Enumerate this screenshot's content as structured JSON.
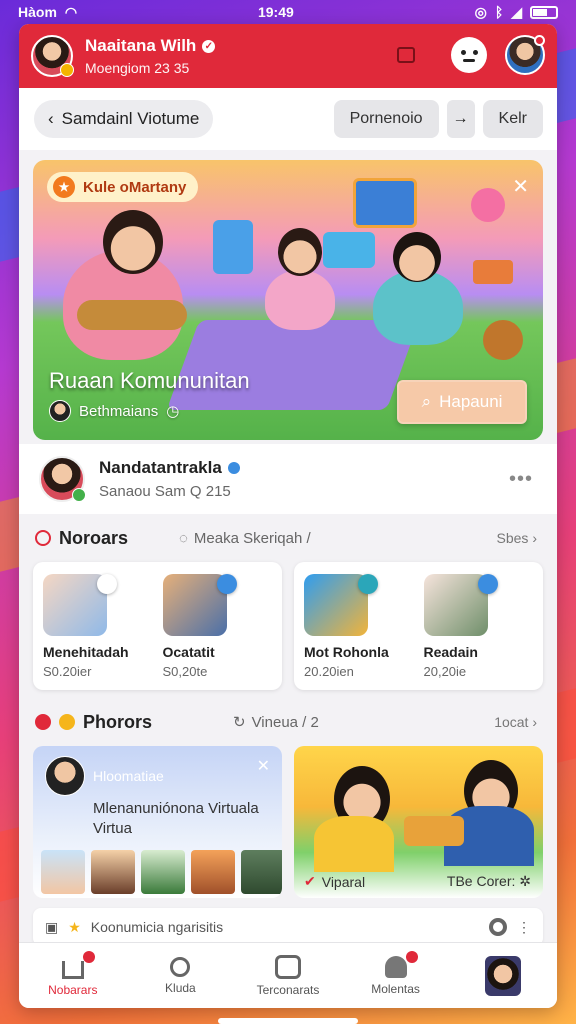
{
  "status": {
    "carrier": "Hàom",
    "time": "19:49"
  },
  "header": {
    "name": "Naaitana Wilh",
    "subtitle": "Moengiom 23 35"
  },
  "nav": {
    "back_label": "Samdainl Viotume",
    "primary_label": "Pornenoio",
    "secondary_label": "Kelr"
  },
  "hero": {
    "tag": "Kule oMartany",
    "title": "Ruaan Komununitan",
    "subtitle": "Bethmaians",
    "button_label": "Hapauni"
  },
  "profile": {
    "name": "Nandatantrakla",
    "meta": "Sanaou Sam  Q 215"
  },
  "section1": {
    "title": "Noroars",
    "filter": "Meaka Skeriqah /",
    "see_all": "Sbes"
  },
  "cards": [
    {
      "title": "Menehitadah",
      "meta": "S0.20ier"
    },
    {
      "title": "Ocatatit",
      "meta": "S0,20te"
    },
    {
      "title": "Mot Rohonla",
      "meta": "20.20ien"
    },
    {
      "title": "Readain",
      "meta": "20,20ie"
    }
  ],
  "section2": {
    "title": "Phorors",
    "filter": "Vineua / 2",
    "see_all": "1ocat"
  },
  "rooms": [
    {
      "chip": "Hloomatiae",
      "line1": "Mlenanuniónona Virtuala",
      "line2": "Virtua"
    },
    {
      "footer": "Viparal",
      "footer_right": "TBe Corer:"
    }
  ],
  "community": {
    "label": "Koonumicia ngarisitis"
  },
  "tabs": [
    "Nobarars",
    "Kluda",
    "Terconarats",
    "Molentas"
  ],
  "colors": {
    "accent": "#e0293a"
  }
}
